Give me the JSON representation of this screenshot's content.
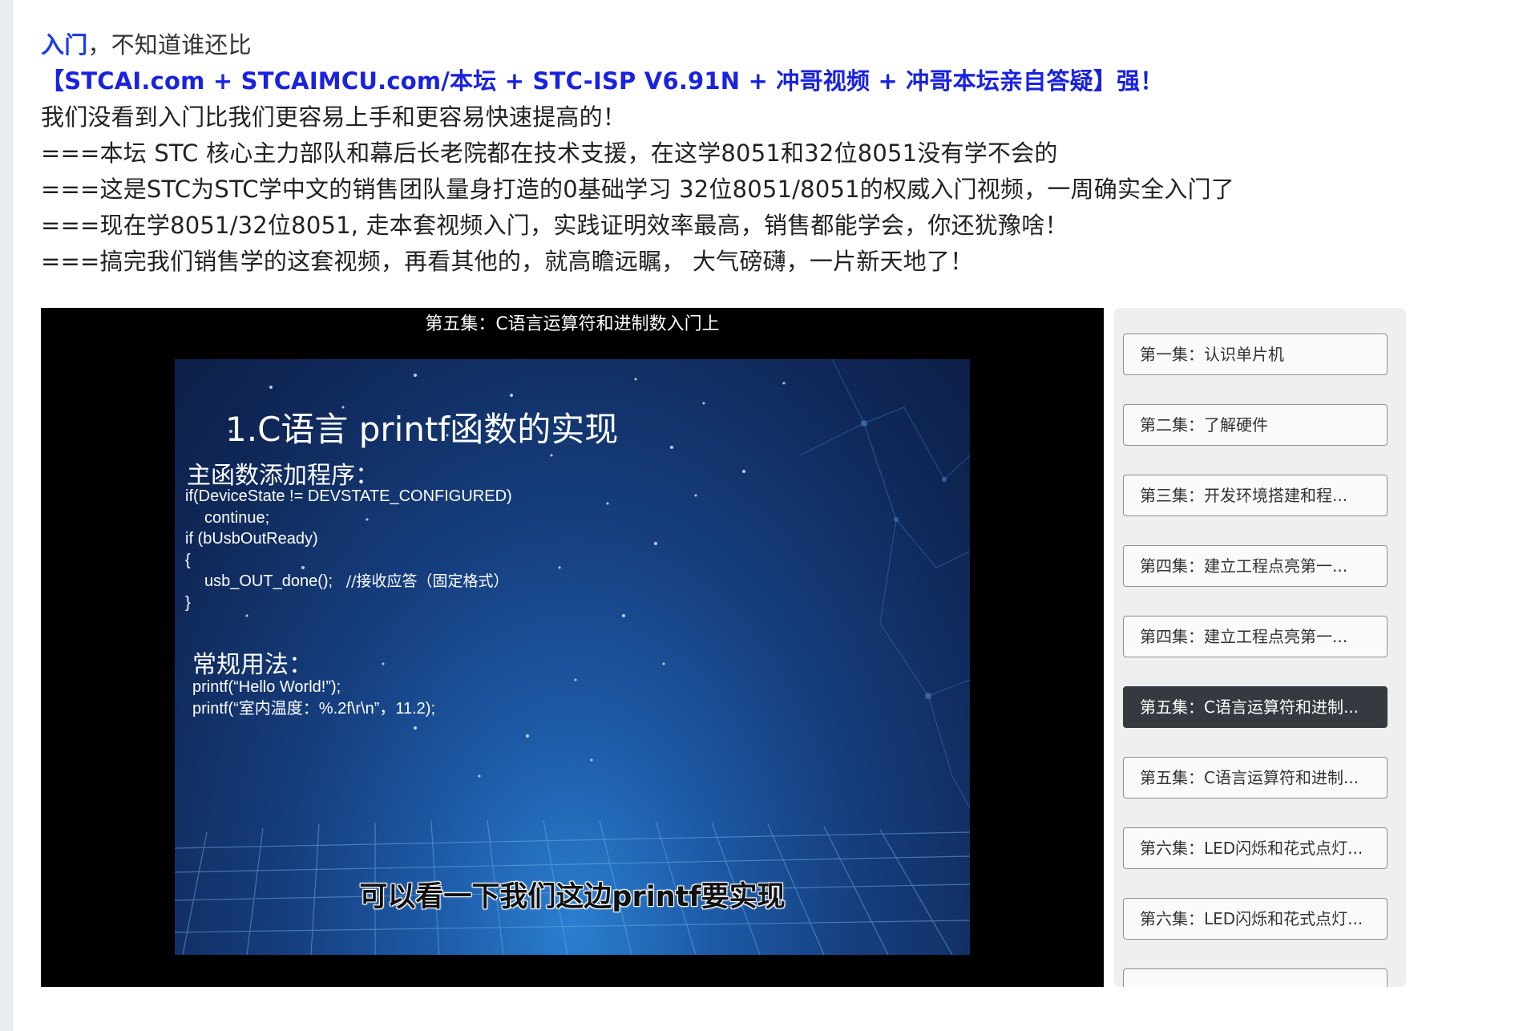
{
  "intro": {
    "keyword": "入门",
    "line1_rest": "，不知道谁还比",
    "line2": "【STCAI.com + STCAIMCU.com/本坛 + STC-ISP V6.91N + 冲哥视频 + 冲哥本坛亲自答疑】强！",
    "line3": "我们没看到入门比我们更容易上手和更容易快速提高的！",
    "line4": "===本坛 STC  核心主力部队和幕后长老院都在技术支援，在这学8051和32位8051没有学不会的",
    "line5": "===这是STC为STC学中文的销售团队量身打造的0基础学习 32位8051/8051的权威入门视频，一周确实全入门了",
    "line6": "===现在学8051/32位8051, 走本套视频入门，实践证明效率最高，销售都能学会，你还犹豫啥！",
    "line7": "===搞完我们销售学的这套视频，再看其他的，就高瞻远瞩， 大气磅礴，一片新天地了！"
  },
  "player": {
    "title": "第五集：C语言运算符和进制数入门上",
    "slide": {
      "heading": "1.C语言 printf函数的实现",
      "section1_label": "主函数添加程序：",
      "code1_l1": "if(DeviceState != DEVSTATE_CONFIGURED)",
      "code1_l2": "continue;",
      "code1_l3": "if (bUsbOutReady)",
      "code1_l4": "{",
      "code1_l5": "usb_OUT_done();",
      "code1_comment": "//接收应答（固定格式）",
      "code1_l6": "}",
      "section2_label": "常规用法：",
      "code2_l1": "printf(“Hello World!”);",
      "code2_l2": "printf(“室内温度：%.2f\\r\\n”，11.2);"
    },
    "subtitle": "可以看一下我们这边printf要实现"
  },
  "playlist": {
    "active_color": "#343a40",
    "items": [
      {
        "label": "第一集：认识单片机"
      },
      {
        "label": "第二集：了解硬件"
      },
      {
        "label": "第三集：开发环境搭建和程..."
      },
      {
        "label": "第四集：建立工程点亮第一..."
      },
      {
        "label": "第四集：建立工程点亮第一..."
      },
      {
        "label": "第五集：C语言运算符和进制..."
      },
      {
        "label": "第五集：C语言运算符和进制..."
      },
      {
        "label": "第六集：LED闪烁和花式点灯..."
      },
      {
        "label": "第六集：LED闪烁和花式点灯..."
      },
      {
        "label": ""
      }
    ]
  }
}
